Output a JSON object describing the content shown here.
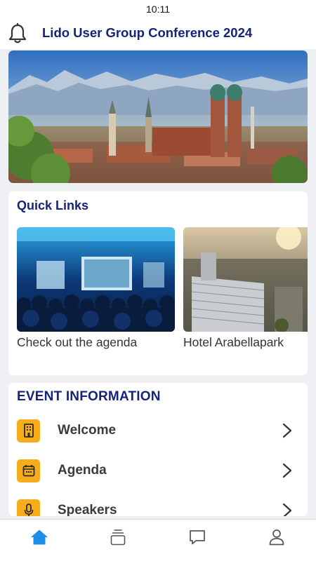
{
  "status_bar": {
    "time": "10:11"
  },
  "header": {
    "title": "Lido User Group Conference 2024",
    "notification_icon": "bell-icon"
  },
  "hero": {
    "image_description": "Munich skyline with Frauenkirche towers and Alps"
  },
  "quick_links": {
    "title": "Quick Links",
    "items": [
      {
        "label": "Check out the agenda",
        "image": "conference-audience-photo"
      },
      {
        "label": "Hotel Arabellapark",
        "image": "hotel-aerial-photo"
      }
    ]
  },
  "event_information": {
    "title": "EVENT INFORMATION",
    "items": [
      {
        "label": "Welcome",
        "icon": "building-icon"
      },
      {
        "label": "Agenda",
        "icon": "calendar-icon"
      },
      {
        "label": "Speakers",
        "icon": "microphone-icon"
      }
    ]
  },
  "bottom_nav": {
    "items": [
      {
        "icon": "home-icon",
        "active": true
      },
      {
        "icon": "stack-icon",
        "active": false
      },
      {
        "icon": "chat-icon",
        "active": false
      },
      {
        "icon": "profile-icon",
        "active": false
      }
    ]
  },
  "colors": {
    "brand_navy": "#16237a",
    "accent_orange": "#f7ad1b",
    "nav_active": "#1d8fe6",
    "background": "#eef0f4"
  }
}
